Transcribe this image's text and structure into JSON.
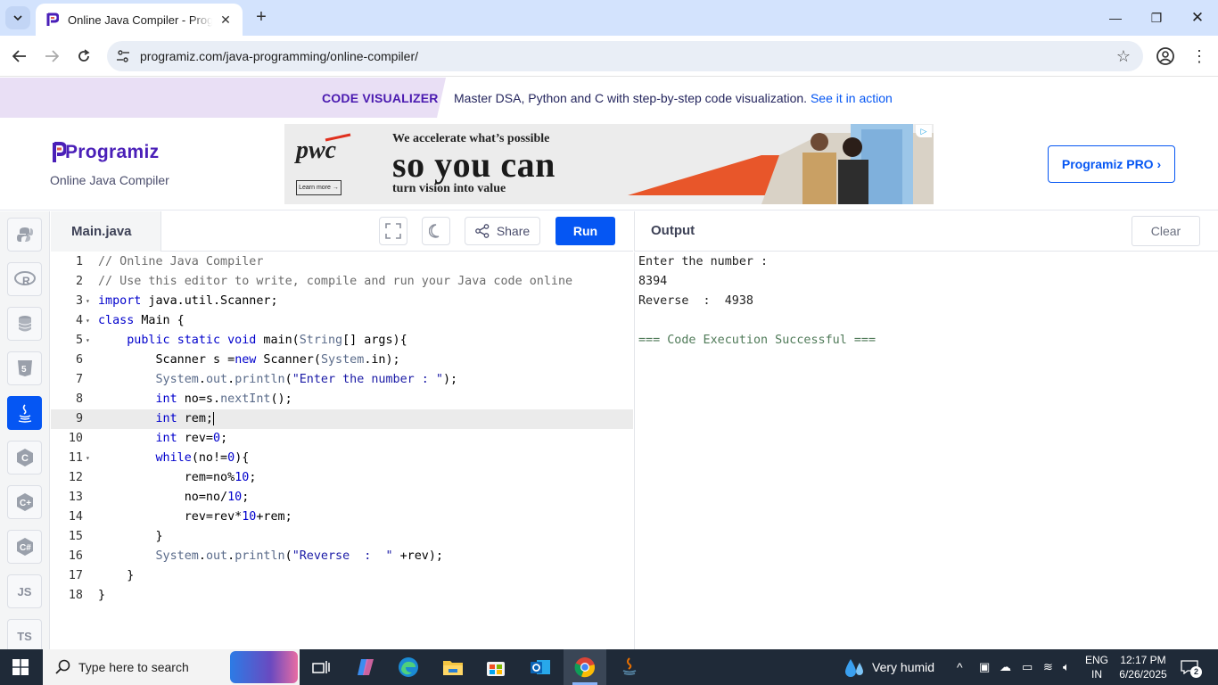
{
  "browser": {
    "tab_title": "Online Java Compiler - Programiz",
    "url": "programiz.com/java-programming/online-compiler/",
    "icons": [
      "tab-search-icon",
      "programiz-favicon-icon",
      "close-icon",
      "plus-icon",
      "minimize-icon",
      "restore-icon",
      "close-window-icon",
      "back-icon",
      "forward-icon",
      "reload-icon",
      "site-settings-icon",
      "star-icon",
      "profile-icon",
      "kebab-menu-icon"
    ]
  },
  "promo": {
    "tag": "CODE VISUALIZER",
    "text": "Master DSA, Python and C with step-by-step code visualization.",
    "link": "See it in action"
  },
  "header": {
    "logo": "Programiz",
    "subtitle": "Online Java Compiler",
    "pro_button": "Programiz PRO ›"
  },
  "ad": {
    "brand": "pwc",
    "learn_more": "Learn more →",
    "line1": "We accelerate what’s possible",
    "line2": "so you can",
    "line3": "turn vision into value"
  },
  "rail": {
    "items": [
      {
        "name": "python",
        "label": ""
      },
      {
        "name": "r",
        "label": ""
      },
      {
        "name": "sql",
        "label": ""
      },
      {
        "name": "html",
        "label": ""
      },
      {
        "name": "java",
        "label": ""
      },
      {
        "name": "c",
        "label": ""
      },
      {
        "name": "cpp",
        "label": ""
      },
      {
        "name": "csharp",
        "label": ""
      },
      {
        "name": "js",
        "label": "JS"
      },
      {
        "name": "ts",
        "label": "TS"
      }
    ],
    "active": "java"
  },
  "editor": {
    "file_name": "Main.java",
    "share_label": "Share",
    "run_label": "Run",
    "active_line": 9,
    "lines": [
      "// Online Java Compiler",
      "// Use this editor to write, compile and run your Java code online",
      "import java.util.Scanner;",
      "class Main {",
      "    public static void main(String[] args){",
      "        Scanner s =new Scanner(System.in);",
      "        System.out.println(\"Enter the number : \");",
      "        int no=s.nextInt();",
      "        int rem;",
      "        int rev=0;",
      "        while(no!=0){",
      "            rem=no%10;",
      "            no=no/10;",
      "            rev=rev*10+rem;",
      "        }",
      "        System.out.println(\"Reverse  :  \" +rev);",
      "    }",
      "}"
    ],
    "line_numbers": [
      "1",
      "2",
      "3",
      "4",
      "5",
      "6",
      "7",
      "8",
      "9",
      "10",
      "11",
      "12",
      "13",
      "14",
      "15",
      "16",
      "17",
      "18"
    ],
    "fold_lines": [
      3,
      4,
      5,
      11
    ]
  },
  "output": {
    "title": "Output",
    "clear_label": "Clear",
    "lines": [
      "Enter the number : ",
      "8394",
      "Reverse  :  4938",
      "",
      "=== Code Execution Successful ==="
    ]
  },
  "taskbar": {
    "search_placeholder": "Type here to search",
    "weather": "Very humid",
    "lang_top": "ENG",
    "lang_bottom": "IN",
    "time": "12:17 PM",
    "date": "6/26/2025",
    "notification_count": "2",
    "apps": [
      "task-view",
      "copilot",
      "edge",
      "file-explorer",
      "store",
      "outlook",
      "chrome",
      "java-app"
    ]
  }
}
